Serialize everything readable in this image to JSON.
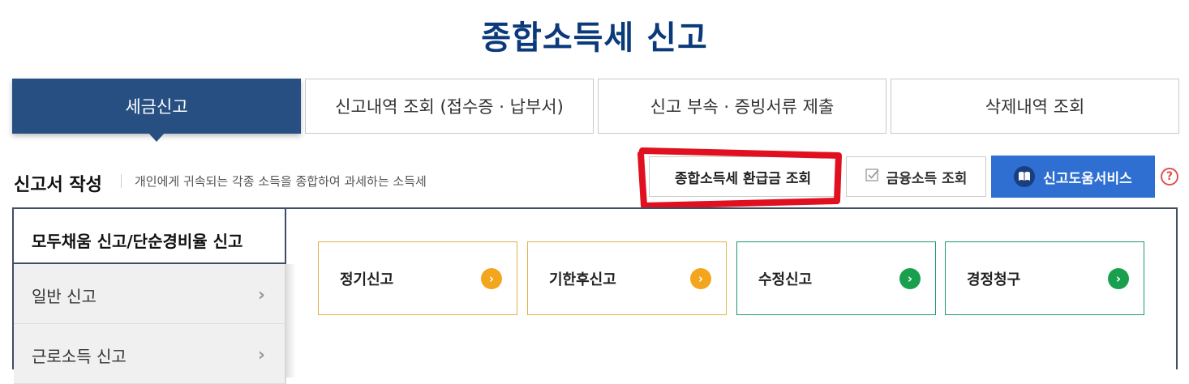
{
  "page": {
    "title": "종합소득세 신고"
  },
  "tabs": [
    {
      "label": "세금신고"
    },
    {
      "label": "신고내역 조회 (접수증 · 납부서)"
    },
    {
      "label": "신고 부속 · 증빙서류 제출"
    },
    {
      "label": "삭제내역 조회"
    }
  ],
  "section": {
    "title": "신고서 작성",
    "description": "개인에게 귀속되는 각종 소득을 종합하여 과세하는 소득세"
  },
  "buttons": {
    "refund_inquiry": "종합소득세 환급금 조회",
    "financial_income": "금융소득 조회",
    "help_service": "신고도움서비스",
    "help_icon": "?"
  },
  "sidebar": {
    "items": [
      {
        "label": "모두채움 신고/단순경비율 신고"
      },
      {
        "label": "일반 신고"
      },
      {
        "label": "근로소득 신고"
      }
    ]
  },
  "cards": [
    {
      "label": "정기신고"
    },
    {
      "label": "기한후신고"
    },
    {
      "label": "수정신고"
    },
    {
      "label": "경정청구"
    }
  ],
  "colors": {
    "title": "#0b3a7a",
    "active_tab": "#274f82",
    "help_button": "#2e6fd1",
    "orange_accent": "#f2a51d",
    "green_accent": "#18a04e",
    "annotation": "#e01020"
  },
  "icons": [
    "checkbox-icon",
    "book-icon",
    "question-icon",
    "chevron-right-icon",
    "arrow-circle-icon"
  ]
}
